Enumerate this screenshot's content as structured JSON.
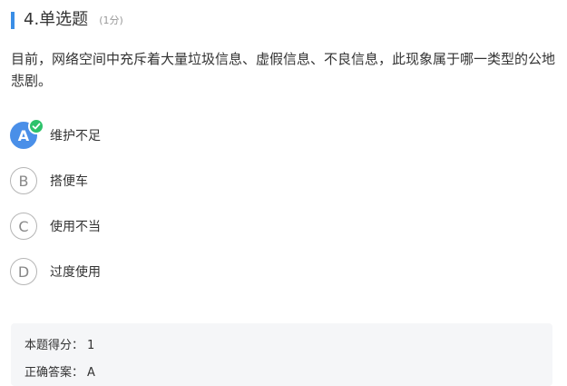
{
  "question": {
    "number_title": "4.单选题",
    "score": "(1分)",
    "stem": "目前，网络空间中充斥着大量垃圾信息、虚假信息、不良信息，此现象属于哪一类型的公地悲剧。"
  },
  "options": [
    {
      "letter": "A",
      "text": "维护不足",
      "selected": true
    },
    {
      "letter": "B",
      "text": "搭便车",
      "selected": false
    },
    {
      "letter": "C",
      "text": "使用不当",
      "selected": false
    },
    {
      "letter": "D",
      "text": "过度使用",
      "selected": false
    }
  ],
  "result": {
    "score_label": "本题得分：",
    "score_value": "1",
    "answer_label": "正确答案：",
    "answer_value": "A"
  },
  "colors": {
    "accent": "#3a8ee6",
    "selected": "#4a8fe8",
    "correct": "#2dc26b"
  },
  "icons": {
    "check": "check-icon"
  }
}
